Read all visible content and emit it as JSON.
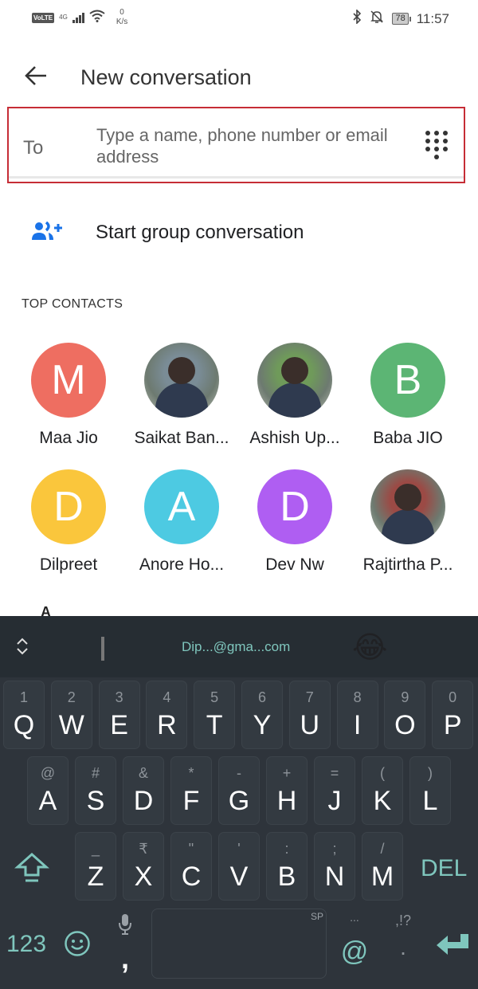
{
  "status_bar": {
    "volte": "VoLTE",
    "network": "4G",
    "speed_value": "0",
    "speed_unit": "K/s",
    "battery": "78",
    "time": "11:57"
  },
  "header": {
    "back_icon": "arrow-back-icon",
    "title": "New conversation"
  },
  "to_field": {
    "label": "To",
    "placeholder": "Type a name, phone number or email address",
    "value": "",
    "dialpad_icon": "dialpad-icon"
  },
  "group": {
    "icon": "group-add-icon",
    "label": "Start group conversation"
  },
  "top_contacts": {
    "title": "TOP CONTACTS",
    "items": [
      {
        "name": "Maa Jio",
        "initial": "M",
        "color": "#ee6e61",
        "photo": false
      },
      {
        "name": "Saikat Ban...",
        "initial": "",
        "color": "#7a8c96",
        "photo": true
      },
      {
        "name": "Ashish Up...",
        "initial": "",
        "color": "#6f9a5a",
        "photo": true
      },
      {
        "name": "Baba JIO",
        "initial": "B",
        "color": "#5cb574",
        "photo": false
      },
      {
        "name": "Dilpreet",
        "initial": "D",
        "color": "#fac63c",
        "photo": false
      },
      {
        "name": "Anore Ho...",
        "initial": "A",
        "color": "#4dcae2",
        "photo": false
      },
      {
        "name": "Dev Nw",
        "initial": "D",
        "color": "#af5ef2",
        "photo": false
      },
      {
        "name": "Rajtirtha P...",
        "initial": "",
        "color": "#9b4a45",
        "photo": true
      }
    ]
  },
  "index_letter": "A",
  "keyboard": {
    "suggestion": "Dip...@gma...com",
    "emoji": "😂",
    "row1": [
      {
        "main": "Q",
        "hint": "1"
      },
      {
        "main": "W",
        "hint": "2"
      },
      {
        "main": "E",
        "hint": "3"
      },
      {
        "main": "R",
        "hint": "4"
      },
      {
        "main": "T",
        "hint": "5"
      },
      {
        "main": "Y",
        "hint": "6"
      },
      {
        "main": "U",
        "hint": "7"
      },
      {
        "main": "I",
        "hint": "8"
      },
      {
        "main": "O",
        "hint": "9"
      },
      {
        "main": "P",
        "hint": "0"
      }
    ],
    "row2": [
      {
        "main": "A",
        "hint": "@"
      },
      {
        "main": "S",
        "hint": "#"
      },
      {
        "main": "D",
        "hint": "&"
      },
      {
        "main": "F",
        "hint": "*"
      },
      {
        "main": "G",
        "hint": "-"
      },
      {
        "main": "H",
        "hint": "+"
      },
      {
        "main": "J",
        "hint": "="
      },
      {
        "main": "K",
        "hint": "("
      },
      {
        "main": "L",
        "hint": ")"
      }
    ],
    "row3": [
      {
        "main": "Z",
        "hint": "_"
      },
      {
        "main": "X",
        "hint": "₹"
      },
      {
        "main": "C",
        "hint": "\""
      },
      {
        "main": "V",
        "hint": "'"
      },
      {
        "main": "B",
        "hint": ":"
      },
      {
        "main": "N",
        "hint": ";"
      },
      {
        "main": "M",
        "hint": "/"
      }
    ],
    "shift_icon": "shift-icon",
    "del": "DEL",
    "num_key": "123",
    "emoji_key_icon": "smiley-icon",
    "mic_icon": "mic-icon",
    "comma": ",",
    "space_hint": "SP",
    "at_hint": "...",
    "at": "@",
    "period_hint": ",!?",
    "period": ".",
    "enter_icon": "enter-icon",
    "accent": "#7fc6bd"
  }
}
